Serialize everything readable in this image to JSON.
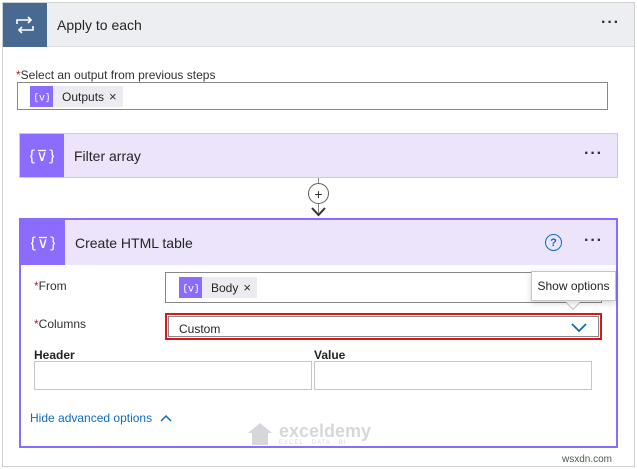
{
  "apply_to_each": {
    "title": "Apply to each",
    "more_label": "···",
    "select_output_label": "Select an output from previous steps",
    "required_mark": "*",
    "token_label": "Outputs",
    "token_remove": "×"
  },
  "filter_array": {
    "title": "Filter array",
    "more_label": "···"
  },
  "add_step_glyph": "+",
  "create_html_table": {
    "title": "Create HTML table",
    "help_glyph": "?",
    "more_label": "···",
    "from_label": "From",
    "from_token_label": "Body",
    "from_token_remove": "×",
    "columns_label": "Columns",
    "columns_value": "Custom",
    "tooltip_text": "Show options",
    "header_column_label": "Header",
    "value_column_label": "Value",
    "advanced_link_label": "Hide advanced options"
  },
  "watermark": {
    "title": "exceldemy",
    "subtitle": "EXCEL · DATA · BI"
  },
  "site_mark": "wsxdn.com",
  "colors": {
    "loop_blue": "#486991",
    "data_ops_purple": "#8c6cff",
    "card_header_bg": "#ebe4fb",
    "highlight_red": "#e0131a",
    "link_blue": "#0f6cbd",
    "required_red": "#a4262c"
  },
  "icons": {
    "loop": "loop-arrows-icon",
    "data_operation": "curly-braces-filter-icon",
    "add": "plus-icon",
    "help": "question-icon",
    "chevron": "chevron-down-icon",
    "collapse": "chevron-up-icon"
  }
}
